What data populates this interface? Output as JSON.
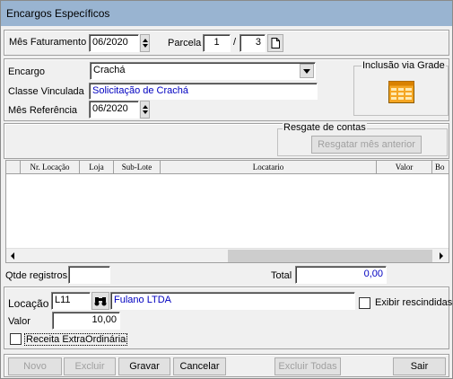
{
  "window": {
    "title": "Encargos Específicos"
  },
  "header": {
    "mes_faturamento_label": "Mês Faturamento",
    "mes_faturamento_value": "06/2020",
    "parcela_label": "Parcela",
    "parcela_value": "1",
    "parcela_sep": "/",
    "parcela_total": "3"
  },
  "encargo": {
    "encargo_label": "Encargo",
    "encargo_value": "Crachá",
    "classe_label": "Classe Vinculada",
    "classe_value": "Solicitação de Crachá",
    "mes_ref_label": "Mês Referência",
    "mes_ref_value": "06/2020",
    "inclusao_label": "Inclusão via Grade"
  },
  "resgate": {
    "group_label": "Resgate de contas",
    "button_label": "Resgatar mês anterior"
  },
  "grid": {
    "columns": [
      "Nr. Locação",
      "Loja",
      "Sub-Lote",
      "Locatario",
      "Valor",
      "Bo"
    ],
    "rows": []
  },
  "totals": {
    "qtde_label": "Qtde registros",
    "qtde_value": "",
    "total_label": "Total",
    "total_value": "0,00"
  },
  "locacao": {
    "locacao_label": "Locação",
    "locacao_value": "L11",
    "locatario_value": "Fulano LTDA",
    "exibir_label": "Exibir rescindidas",
    "valor_label": "Valor",
    "valor_value": "10,00",
    "receita_label": "Receita ExtraOrdinária"
  },
  "toolbar": {
    "novo": "Novo",
    "excluir": "Excluir",
    "gravar": "Gravar",
    "cancelar": "Cancelar",
    "excluir_todas": "Excluir Todas",
    "sair": "Sair"
  }
}
